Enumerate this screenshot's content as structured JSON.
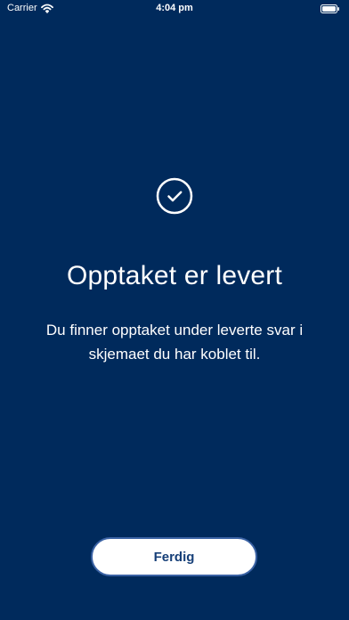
{
  "status_bar": {
    "carrier": "Carrier",
    "time": "4:04 pm"
  },
  "content": {
    "title": "Opptaket er levert",
    "description": "Du finner opptaket under leverte svar i skjemaet du har koblet til."
  },
  "actions": {
    "done_label": "Ferdig"
  },
  "colors": {
    "background": "#002a5c",
    "button_text": "#163f78",
    "button_border": "#3a62a4"
  },
  "icons": {
    "status_wifi": "wifi-icon",
    "status_battery": "battery-icon",
    "success": "check-circle-icon"
  }
}
